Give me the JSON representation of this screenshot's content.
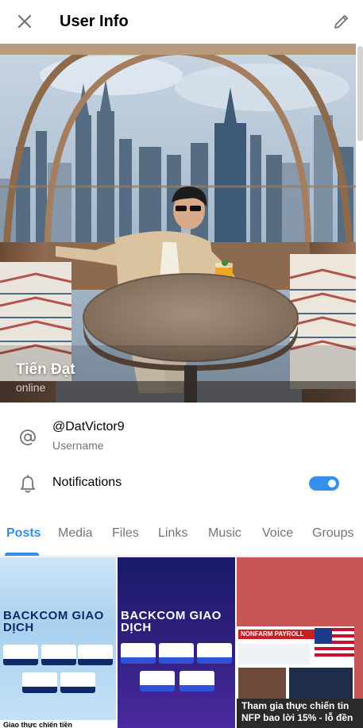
{
  "header": {
    "title": "User Info"
  },
  "profile": {
    "name": "Tiến Đạt",
    "status": "online"
  },
  "username": {
    "value": "@DatVictor9",
    "label": "Username"
  },
  "notifications": {
    "label": "Notifications",
    "enabled": true
  },
  "tabs": [
    {
      "label": "Posts",
      "active": true
    },
    {
      "label": "Media",
      "active": false
    },
    {
      "label": "Files",
      "active": false
    },
    {
      "label": "Links",
      "active": false
    },
    {
      "label": "Music",
      "active": false
    },
    {
      "label": "Voice",
      "active": false
    },
    {
      "label": "Groups",
      "active": false
    }
  ],
  "posts": [
    {
      "title": "BACKCOM GIAO DỊCH",
      "caption": "Giao thực chiến tiền"
    },
    {
      "title": "BACKCOM GIAO DỊCH",
      "caption": ""
    },
    {
      "banner": "NONFARM PAYROLL",
      "caption": "Tham gia thực chiến tin NFP bao lời 15% - lỗ đền"
    }
  ],
  "colors": {
    "accent": "#3390ec",
    "secondary_text": "#707579"
  }
}
